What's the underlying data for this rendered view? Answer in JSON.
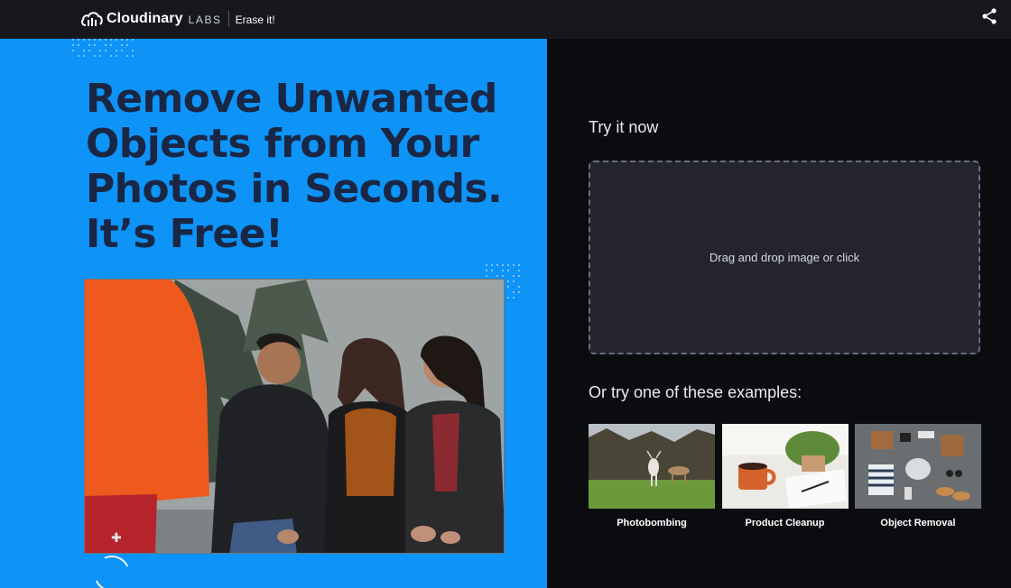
{
  "topbar": {
    "brand_name": "Cloudinary",
    "brand_labs": "LABS",
    "product_name": "Erase it!",
    "share_icon": "share-icon",
    "logo_icon": "cloud-logo-icon"
  },
  "hero": {
    "headline_lines": [
      "Remove Unwanted",
      "Objects from Your",
      "Photos in Seconds.",
      "It’s Free!"
    ],
    "accent_color": "#0e93f7",
    "headline_color": "#1a2744"
  },
  "upload": {
    "title": "Try it now",
    "dropzone_text": "Drag and drop image or click"
  },
  "examples": {
    "title": "Or try one of these examples:",
    "items": [
      {
        "label": "Photobombing"
      },
      {
        "label": "Product Cleanup"
      },
      {
        "label": "Object Removal"
      }
    ]
  }
}
